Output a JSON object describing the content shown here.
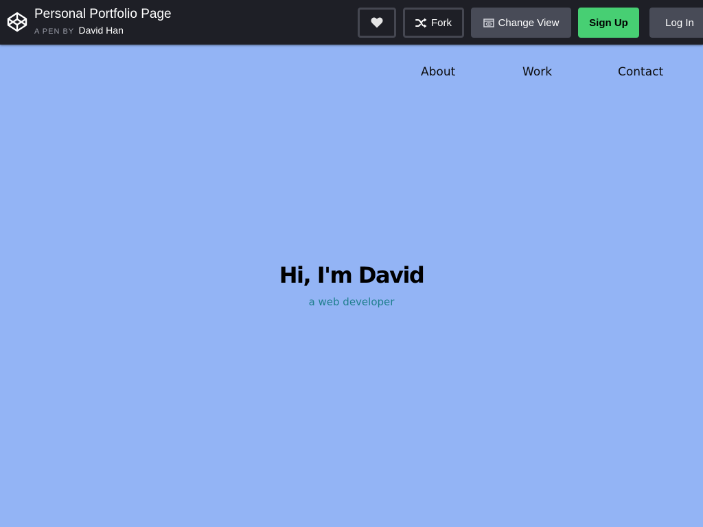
{
  "header": {
    "pen_title": "Personal Portfolio Page",
    "pen_by": "A PEN BY",
    "author": "David Han",
    "buttons": {
      "fork": "Fork",
      "change_view": "Change View",
      "sign_up": "Sign Up",
      "log_in": "Log In"
    },
    "icons": {
      "logo": "codepen-logo-icon",
      "heart": "heart-icon",
      "fork": "fork-icon",
      "change_view": "change-view-icon"
    }
  },
  "nav": {
    "items": [
      "About",
      "Work",
      "Contact"
    ]
  },
  "hero": {
    "title": "Hi, I'm David",
    "subtitle": "a web developer"
  },
  "colors": {
    "topbar": "#1e1f26",
    "page_background": "#93b4f5",
    "sign_up": "#47cf73",
    "secondary_button": "#484b57",
    "subtitle": "#1f7f8e"
  }
}
